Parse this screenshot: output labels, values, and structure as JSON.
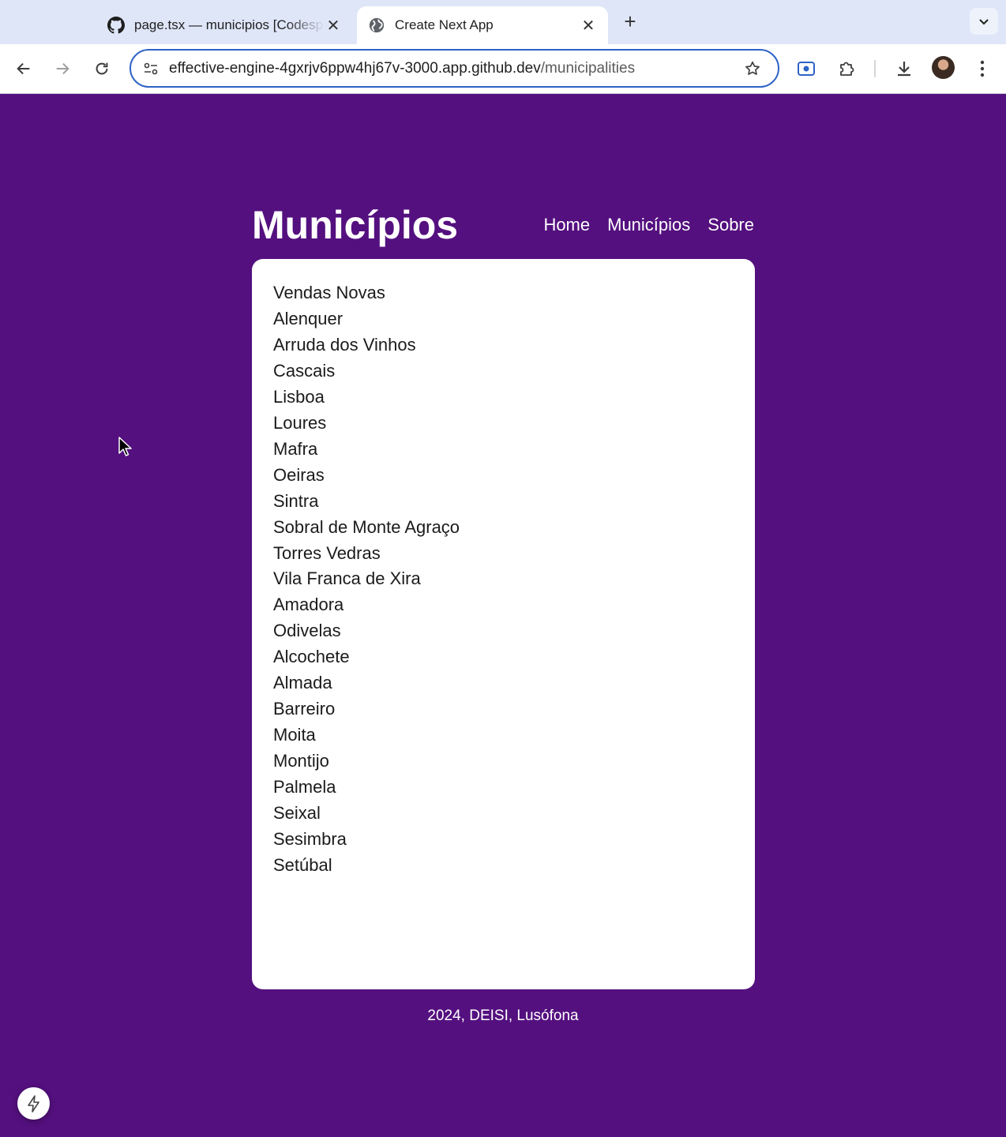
{
  "browser": {
    "tabs": [
      {
        "title": "page.tsx — municipios [Codespaces]",
        "icon": "github-icon"
      },
      {
        "title": "Create Next App",
        "icon": "globe-icon",
        "active": true
      }
    ],
    "url_host": "effective-engine-4gxrjv6ppw4hj67v-3000.app.github.dev",
    "url_path": "/municipalities"
  },
  "page": {
    "title": "Municípios",
    "nav": [
      "Home",
      "Municípios",
      "Sobre"
    ],
    "municipalities": [
      "Vendas Novas",
      "Alenquer",
      "Arruda dos Vinhos",
      "Cascais",
      "Lisboa",
      "Loures",
      "Mafra",
      "Oeiras",
      "Sintra",
      "Sobral de Monte Agraço",
      "Torres Vedras",
      "Vila Franca de Xira",
      "Amadora",
      "Odivelas",
      "Alcochete",
      "Almada",
      "Barreiro",
      "Moita",
      "Montijo",
      "Palmela",
      "Seixal",
      "Sesimbra",
      "Setúbal"
    ],
    "footer": "2024, DEISI, Lusófona"
  },
  "colors": {
    "background": "#54107f",
    "card": "#ffffff",
    "omnibox_border": "#2e63c6"
  }
}
